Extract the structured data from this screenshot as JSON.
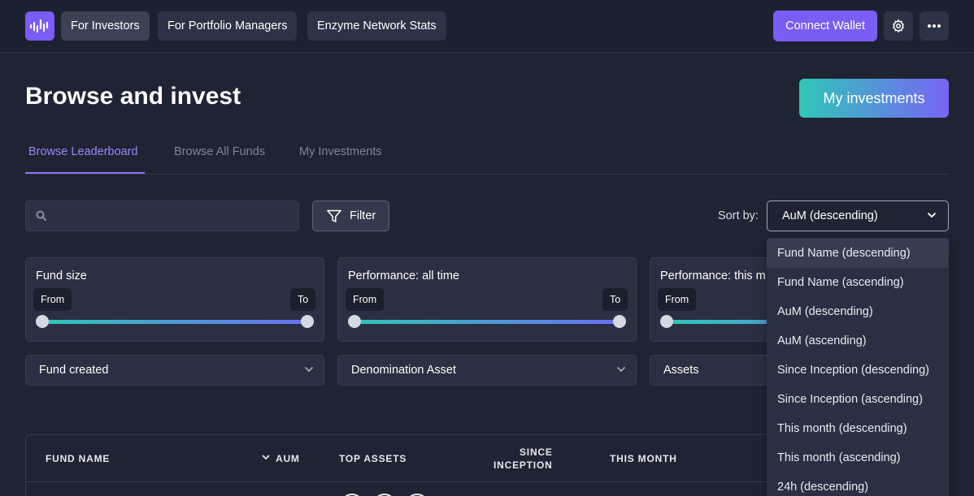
{
  "nav": {
    "links": [
      "For Investors",
      "For Portfolio Managers",
      "Enzyme Network Stats"
    ],
    "connect_wallet": "Connect Wallet",
    "settings_icon": "gear-icon",
    "more_icon": "more-icon"
  },
  "header": {
    "title": "Browse and invest",
    "my_investments_button": "My investments"
  },
  "tabs": [
    "Browse Leaderboard",
    "Browse All Funds",
    "My Investments"
  ],
  "toolbar": {
    "search_placeholder": "",
    "filter_label": "Filter",
    "sort_label": "Sort by:",
    "sort_value": "AuM (descending)"
  },
  "range_filters": [
    {
      "title": "Fund size",
      "from": "From",
      "to": "To"
    },
    {
      "title": "Performance: all time",
      "from": "From",
      "to": "To"
    },
    {
      "title": "Performance: this m",
      "from": "From"
    }
  ],
  "dropdown_filters": [
    "Fund created",
    "Denomination Asset",
    "Assets"
  ],
  "table": {
    "columns": [
      "FUND NAME",
      "AUM",
      "TOP ASSETS",
      "SINCE",
      "INCEPTION",
      "THIS MONTH"
    ]
  },
  "sort_options": [
    "Fund Name (descending)",
    "Fund Name (ascending)",
    "AuM (descending)",
    "AuM (ascending)",
    "Since Inception (descending)",
    "Since Inception (ascending)",
    "This month (descending)",
    "This month (ascending)",
    "24h (descending)"
  ],
  "colors": {
    "accent": "#7b5cf5",
    "gradient_start": "#2fc7b7",
    "gradient_end": "#7864f6",
    "background": "#1f2433"
  }
}
